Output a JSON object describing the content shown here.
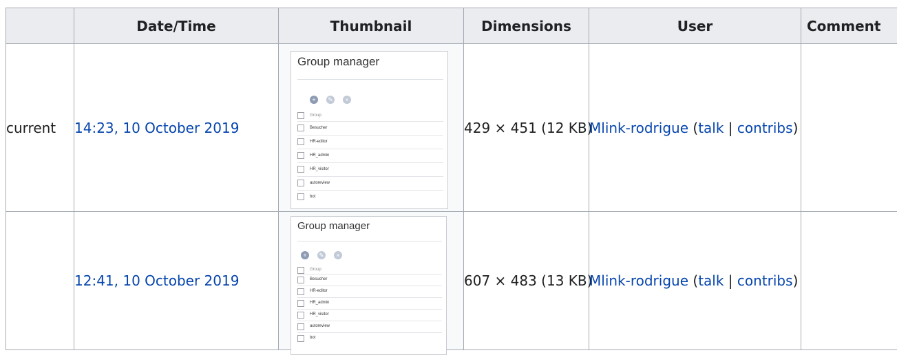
{
  "headers": {
    "status": "",
    "datetime": "Date/Time",
    "thumbnail": "Thumbnail",
    "dimensions": "Dimensions",
    "user": "User",
    "comment": "Comment"
  },
  "rows": [
    {
      "status": "current",
      "datetime": "14:23, 10 October 2019",
      "thumb": {
        "title": "Group manager",
        "icons": [
          "add-icon",
          "edit-icon",
          "delete-icon"
        ],
        "header": "Group",
        "groups": [
          "Besucher",
          "HR-editor",
          "HR_admin",
          "HR_visitor",
          "autoreview",
          "bot"
        ]
      },
      "dimensions": "429 × 451 (12 KB)",
      "user": "Mlink-rodrigue",
      "open_paren": "(",
      "talk": "talk",
      "sep": "|",
      "contribs": "contribs",
      "close_paren": ")",
      "comment": ""
    },
    {
      "status": "",
      "datetime": "12:41, 10 October 2019",
      "thumb": {
        "title": "Group manager",
        "icons": [
          "add-icon",
          "edit-icon",
          "delete-icon"
        ],
        "header": "Group",
        "groups": [
          "Besucher",
          "HR-editor",
          "HR_admin",
          "HR_visitor",
          "autoreview",
          "bot"
        ]
      },
      "dimensions": "607 × 483 (13 KB)",
      "user": "Mlink-rodrigue",
      "open_paren": "(",
      "talk": "talk",
      "sep": "|",
      "contribs": "contribs",
      "close_paren": ")",
      "comment": ""
    }
  ],
  "colors": {
    "link": "#0645ad",
    "header_bg": "#eaecf0",
    "border": "#a2a9b1"
  }
}
